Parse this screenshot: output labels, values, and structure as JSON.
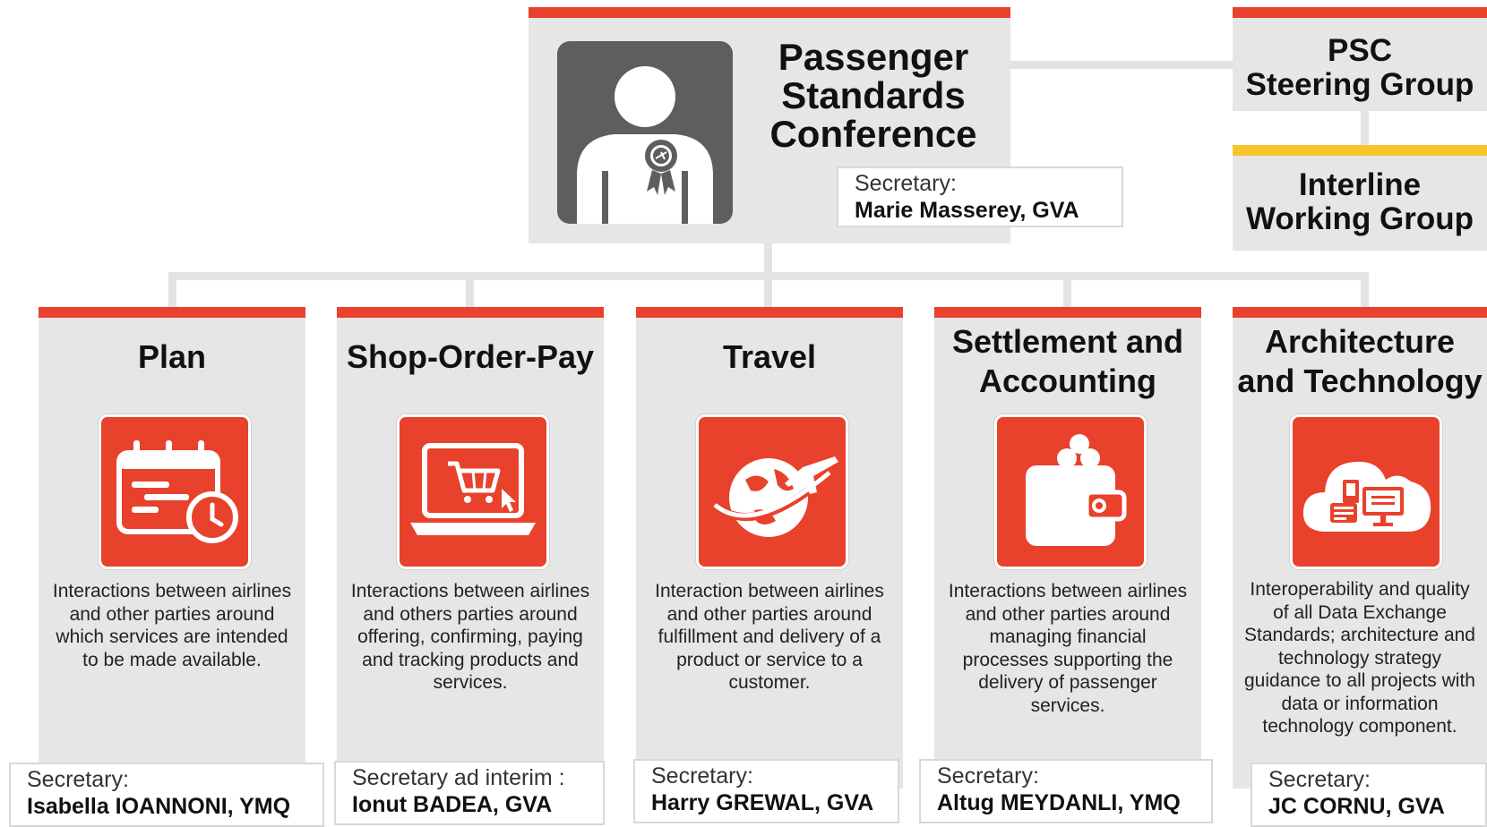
{
  "conference": {
    "title_lines": [
      "Passenger",
      "Standards",
      "Conference"
    ],
    "secretary_label": "Secretary:",
    "secretary_name": "Marie Masserey, GVA"
  },
  "steering_group": {
    "title_lines": [
      "PSC",
      "Steering Group"
    ]
  },
  "interline_group": {
    "title_lines": [
      "Interline",
      "Working Group"
    ]
  },
  "groups": [
    {
      "title_lines": [
        "Plan"
      ],
      "icon": "calendar-clock-icon",
      "description": "Interactions between airlines and other parties around which services are intended to be made available.",
      "secretary_label": "Secretary:",
      "secretary_name": "Isabella IOANNONI, YMQ"
    },
    {
      "title_lines": [
        "Shop-Order-Pay"
      ],
      "icon": "laptop-cart-icon",
      "description": "Interactions between airlines and others parties around offering, confirming, paying and tracking products and services.",
      "secretary_label": "Secretary ad interim :",
      "secretary_name": "Ionut BADEA, GVA"
    },
    {
      "title_lines": [
        "Travel"
      ],
      "icon": "globe-plane-icon",
      "description": "Interaction between airlines and other parties around fulfillment and delivery of a product or service to a customer.",
      "secretary_label": "Secretary:",
      "secretary_name": "Harry GREWAL, GVA"
    },
    {
      "title_lines": [
        "Settlement and",
        "Accounting"
      ],
      "icon": "wallet-coins-icon",
      "description": "Interactions between airlines and other parties around managing financial processes supporting the delivery of passenger services.",
      "secretary_label": "Secretary:",
      "secretary_name": "Altug MEYDANLI, YMQ"
    },
    {
      "title_lines": [
        "Architecture",
        "and Technology"
      ],
      "icon": "cloud-devices-icon",
      "description": "Interoperability and quality of all Data Exchange Standards; architecture and technology strategy guidance to all projects with data or information technology component.",
      "secretary_label": "Secretary:",
      "secretary_name": "JC CORNU, GVA"
    }
  ],
  "colors": {
    "accent_red": "#e8412c",
    "accent_yellow": "#f5c52a",
    "card_grey": "#e6e6e6",
    "avatar_grey": "#5e5e5e"
  }
}
